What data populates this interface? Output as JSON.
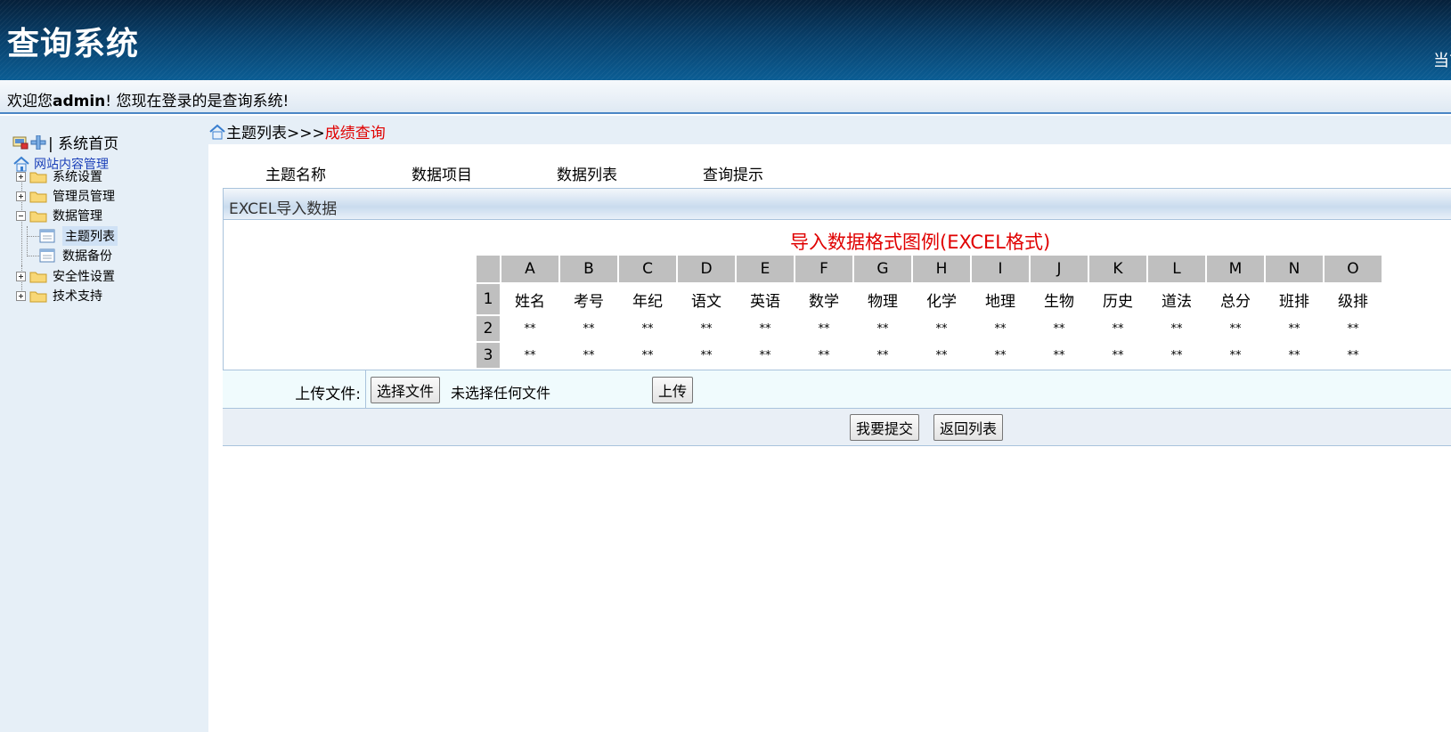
{
  "header": {
    "app_title": "查询系统",
    "right_text": "当前"
  },
  "welcome": {
    "prefix": "欢迎您",
    "user": "admin",
    "suffix": "! 您现在登录的是查询系统!"
  },
  "sidebar": {
    "home_label": "| 系统首页",
    "root_label": "网站内容管理",
    "groups": [
      {
        "label": "系统设置",
        "expanded": false
      },
      {
        "label": "管理员管理",
        "expanded": false
      },
      {
        "label": "数据管理",
        "expanded": true,
        "children": [
          "主题列表",
          "数据备份"
        ]
      },
      {
        "label": "安全性设置",
        "expanded": false
      },
      {
        "label": "技术支持",
        "expanded": false
      }
    ],
    "selected": "主题列表"
  },
  "breadcrumb": {
    "path": "主题列表>>>",
    "current": "成绩查询"
  },
  "tabs": [
    "主题名称",
    "数据项目",
    "数据列表",
    "查询提示"
  ],
  "panel": {
    "title": "EXCEL导入数据",
    "sample_title": "导入数据格式图例(EXCEL格式)",
    "columns": [
      "A",
      "B",
      "C",
      "D",
      "E",
      "F",
      "G",
      "H",
      "I",
      "J",
      "K",
      "L",
      "M",
      "N",
      "O"
    ],
    "row_numbers": [
      "1",
      "2",
      "3"
    ],
    "header_row": [
      "姓名",
      "考号",
      "年纪",
      "语文",
      "英语",
      "数学",
      "物理",
      "化学",
      "地理",
      "生物",
      "历史",
      "道法",
      "总分",
      "班排",
      "级排"
    ],
    "placeholder": "**"
  },
  "upload": {
    "label": "上传文件:",
    "choose_button": "选择文件",
    "no_file_text": "未选择任何文件",
    "upload_button": "上传"
  },
  "actions": {
    "submit": "我要提交",
    "back": "返回列表"
  }
}
